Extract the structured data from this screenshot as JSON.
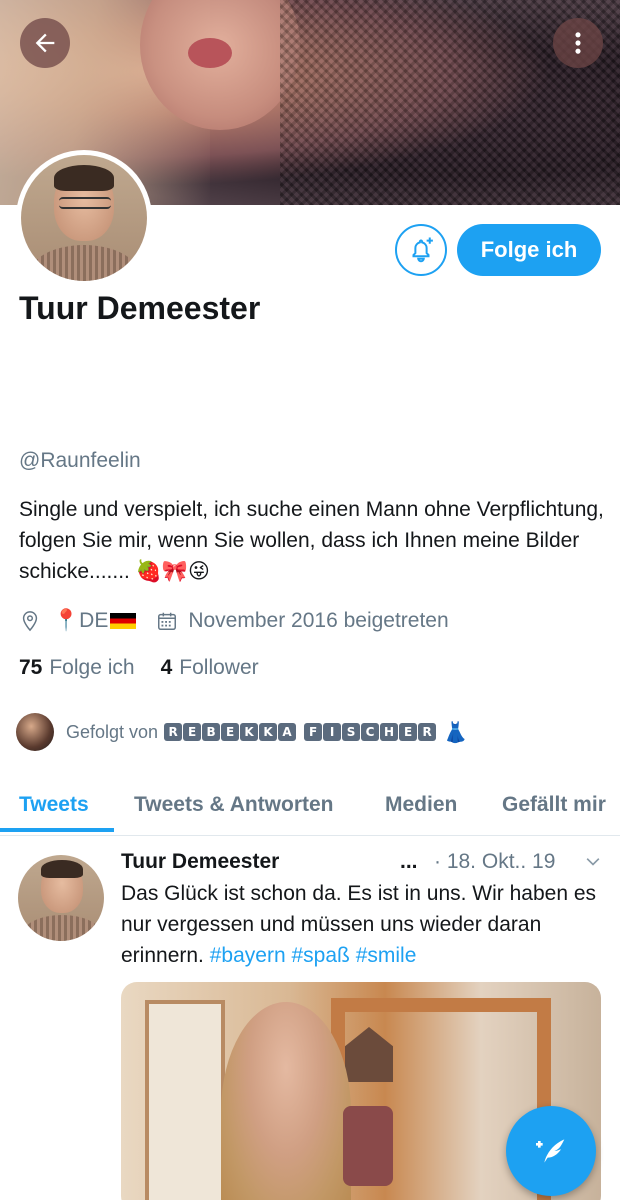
{
  "profile": {
    "name": "Tuur Demeester",
    "handle": "@Raunfeelin",
    "bio": "Single und verspielt, ich suche einen Mann ohne Verpflichtung, folgen Sie mir, wenn Sie wollen, dass ich Ihnen meine Bilder schicke....... 🍓🎀😜",
    "location": "📍DE",
    "joined": "November 2016 beigetreten",
    "following_count": "75",
    "following_label": "Folge ich",
    "followers_count": "4",
    "followers_label": "Follower"
  },
  "actions": {
    "follow_label": "Folge ich"
  },
  "followed_by": {
    "prefix": "Gefolgt von",
    "name_first": [
      "R",
      "E",
      "B",
      "E",
      "K",
      "K",
      "A"
    ],
    "name_last": [
      "F",
      "I",
      "S",
      "C",
      "H",
      "E",
      "R"
    ],
    "suffix_emoji": "👗"
  },
  "tabs": [
    {
      "label": "Tweets",
      "active": true
    },
    {
      "label": "Tweets & Antworten",
      "active": false
    },
    {
      "label": "Medien",
      "active": false
    },
    {
      "label": "Gefällt mir",
      "active": false
    }
  ],
  "tweet": {
    "author": "Tuur Demeester",
    "dots": "...",
    "date": "· 18. Okt.. 19",
    "text": "Das Glück ist schon da. Es ist in uns. Wir haben es nur vergessen und müssen uns wieder daran erinnern.",
    "hashtags": [
      "#bayern",
      "#spaß",
      "#smile"
    ]
  },
  "colors": {
    "accent": "#1da1f2",
    "muted": "#657786",
    "text": "#14171a"
  },
  "icons": {
    "back": "arrow-left-icon",
    "more": "more-vertical-icon",
    "bell": "bell-plus-icon",
    "location": "location-pin-icon",
    "calendar": "calendar-icon",
    "caret": "chevron-down-icon",
    "compose": "compose-feather-icon"
  }
}
